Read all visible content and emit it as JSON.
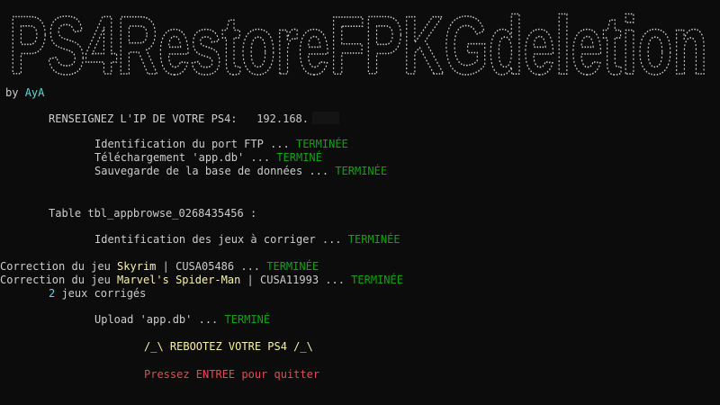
{
  "banner": {
    "text": "PS4RestoreFPKGdeletion",
    "color": "#cccccc"
  },
  "author": {
    "prefix": "by ",
    "name": "AyA"
  },
  "ip_prompt": {
    "label": "RENSEIGNEZ L'IP DE VOTRE PS4:",
    "value": "192.168."
  },
  "steps": [
    {
      "text": "Identification du port FTP ... ",
      "status": "TERMINÉE"
    },
    {
      "text": "Téléchargement 'app.db' ... ",
      "status": "TERMINÉ"
    },
    {
      "text": "Sauvegarde de la base de données ... ",
      "status": "TERMINÉE"
    }
  ],
  "table": {
    "label": "Table tbl_appbrowse_0268435456 :"
  },
  "identify": {
    "text": "Identification des jeux à corriger ... ",
    "status": "TERMINÉE"
  },
  "corrections": [
    {
      "prefix": "Correction du jeu ",
      "game": "Skyrim",
      "sep": " | ",
      "code": "CUSA05486",
      "dots": " ... ",
      "status": "TERMINÉE"
    },
    {
      "prefix": "Correction du jeu ",
      "game": "Marvel's Spider-Man",
      "sep": " | ",
      "code": "CUSA11993",
      "dots": " ... ",
      "status": "TERMINÉE"
    }
  ],
  "corrected_count": {
    "count": "2",
    "text": " jeux corrigés"
  },
  "upload": {
    "text": "Upload 'app.db' ... ",
    "status": "TERMINÉ"
  },
  "reboot": {
    "text": "/_\\ REBOOTEZ VOTRE PS4 /_\\"
  },
  "quit": {
    "text": "Pressez ENTREE pour quitter"
  },
  "colors": {
    "background": "#0c0c0c",
    "text": "#cccccc",
    "success": "#13a10e",
    "highlight": "#f9f1a5",
    "accent": "#61d6d6",
    "warning": "#e74856"
  }
}
